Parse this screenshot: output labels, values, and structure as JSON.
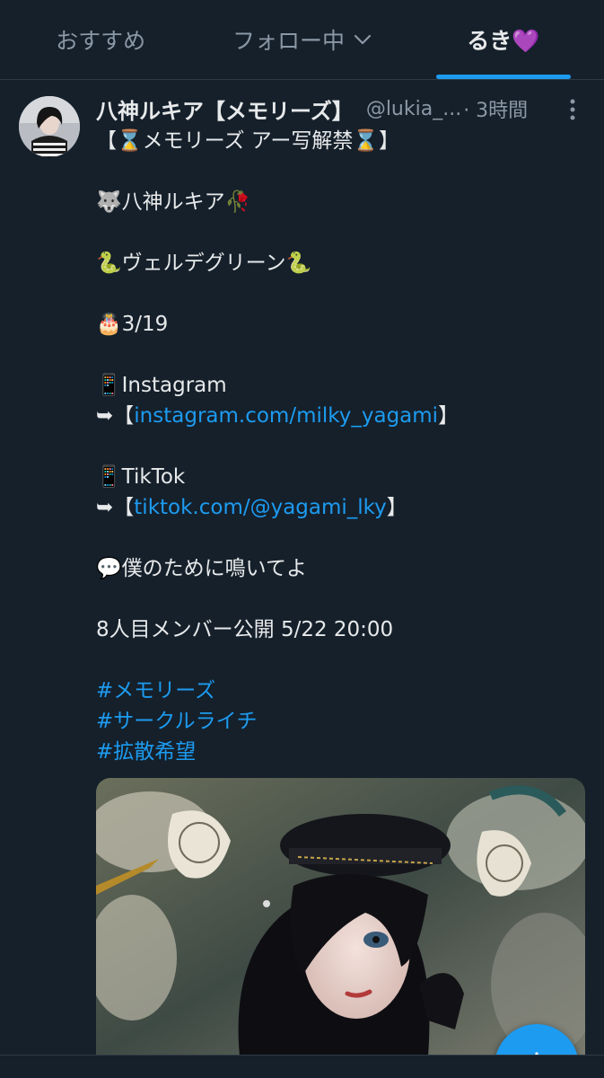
{
  "tabs": {
    "recommended": "おすすめ",
    "following": "フォロー中",
    "list": "るき💜"
  },
  "tweet": {
    "display_name": "八神ルキア【メモリーズ】",
    "handle": "@lukia_...",
    "time": "· 3時間",
    "lines": {
      "l1": "【⌛メモリーズ アー写解禁⌛】",
      "l2": "🐺八神ルキア🥀",
      "l3": "🐍ヴェルデグリーン🐍",
      "l4": "🎂3/19",
      "l5": "📱Instagram",
      "l6_prefix": "➥【",
      "l6_link": "instagram.com/milky_yagami",
      "l6_suffix": "】",
      "l7": "📱TikTok",
      "l8_prefix": "➥【",
      "l8_link": "tiktok.com/@yagami_lky",
      "l8_suffix": "】",
      "l9": "💬僕のために鳴いてよ",
      "l10": "8人目メンバー公開 5/22 20:00",
      "h1": "#メモリーズ",
      "h2": "#サークルライチ",
      "h3": "#拡散希望"
    }
  },
  "colors": {
    "background": "#15202b",
    "accent": "#1d9bf0",
    "text": "#e7e9ea",
    "muted": "#8b98a5"
  }
}
